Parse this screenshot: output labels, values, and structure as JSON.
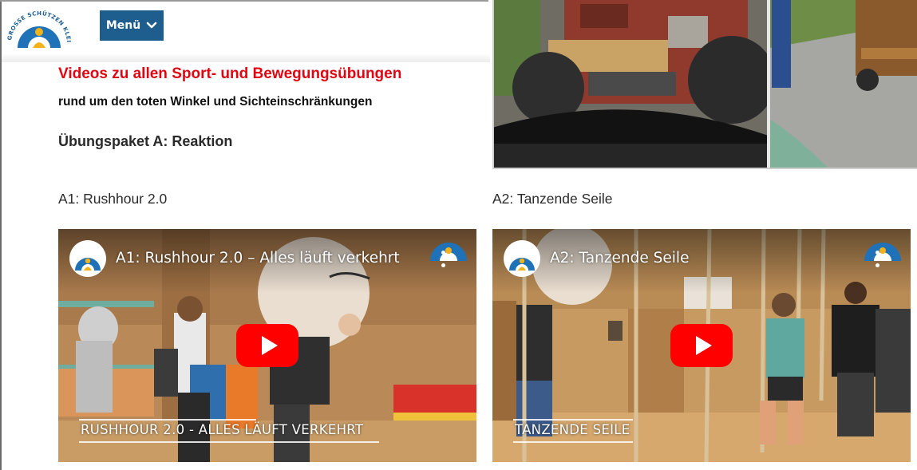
{
  "header": {
    "logo_text": "GROSSE SCHÜTZEN KLEINE",
    "menu_label": "Menü",
    "menu_icon": "chevron-down-icon"
  },
  "main": {
    "title": "Videos zu allen Sport- und Bewegungsübungen",
    "subtitle": "rund um den toten Winkel und Sichteinschränkungen",
    "package_heading": "Übungspaket A: Reaktion",
    "videos": [
      {
        "label": "A1: Rushhour 2.0",
        "player_title": "A1: Rushhour 2.0 – Alles läuft verkehrt",
        "caption": "RUSHHOUR 2.0 - ALLES LÄUFT VERKEHRT"
      },
      {
        "label": "A2: Tanzende Seile",
        "player_title": "A2: Tanzende Seile",
        "caption": "TANZENDE SEILE"
      }
    ]
  },
  "colors": {
    "title_red": "#e10511",
    "menu_blue": "#1d5e8f",
    "youtube_red": "#ff0000"
  }
}
